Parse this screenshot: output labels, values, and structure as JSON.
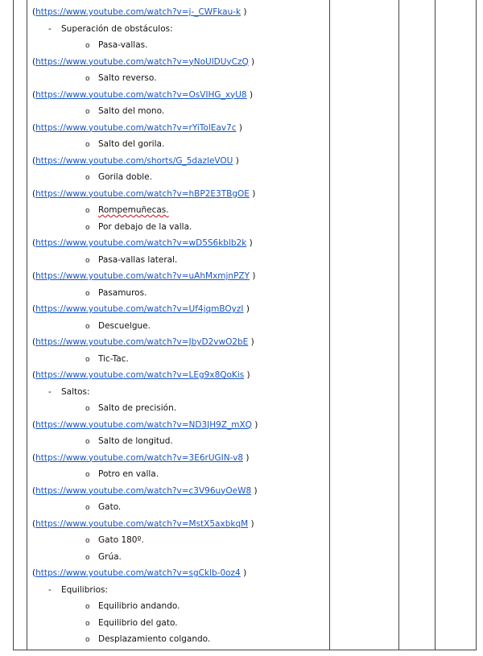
{
  "rows": [
    {
      "kind": "link",
      "url": "https://www.youtube.com/watch?v=j-_CWFkau-k"
    },
    {
      "kind": "section",
      "text": "Superación de obstáculos:"
    },
    {
      "kind": "item",
      "text": "Pasa-vallas."
    },
    {
      "kind": "link",
      "url": "https://www.youtube.com/watch?v=yNoUlDUyCzQ"
    },
    {
      "kind": "item",
      "text": "Salto reverso."
    },
    {
      "kind": "link",
      "url": "https://www.youtube.com/watch?v=OsVIHG_xyU8"
    },
    {
      "kind": "item",
      "text": "Salto del mono."
    },
    {
      "kind": "link",
      "url": "https://www.youtube.com/watch?v=rYiTolEav7c"
    },
    {
      "kind": "item",
      "text": "Salto del gorila."
    },
    {
      "kind": "link",
      "url": "https://www.youtube.com/shorts/G_5dazleVOU"
    },
    {
      "kind": "item",
      "text": "Gorila doble."
    },
    {
      "kind": "link",
      "url": "https://www.youtube.com/watch?v=hBP2E3TBgOE"
    },
    {
      "kind": "item",
      "text": "Rompemuñecas.",
      "spell": true
    },
    {
      "kind": "item",
      "text": "Por debajo de la valla."
    },
    {
      "kind": "link",
      "url": "https://www.youtube.com/watch?v=wD5S6kblb2k"
    },
    {
      "kind": "item",
      "text": "Pasa-vallas lateral."
    },
    {
      "kind": "link",
      "url": "https://www.youtube.com/watch?v=uAhMxmjnPZY"
    },
    {
      "kind": "item",
      "text": "Pasamuros."
    },
    {
      "kind": "link",
      "url": "https://www.youtube.com/watch?v=Uf4jqmBOyzI"
    },
    {
      "kind": "item",
      "text": "Descuelgue."
    },
    {
      "kind": "link",
      "url": "https://www.youtube.com/watch?v=JbyD2vwO2bE"
    },
    {
      "kind": "item",
      "text": "Tic-Tac."
    },
    {
      "kind": "link",
      "url": "https://www.youtube.com/watch?v=LEg9x8QoKis"
    },
    {
      "kind": "section",
      "text": "Saltos:"
    },
    {
      "kind": "item",
      "text": "Salto de precisión."
    },
    {
      "kind": "link",
      "url": "https://www.youtube.com/watch?v=ND3JH9Z_mXQ"
    },
    {
      "kind": "item",
      "text": "Salto de longitud."
    },
    {
      "kind": "link",
      "url": "https://www.youtube.com/watch?v=3E6rUGIN-v8"
    },
    {
      "kind": "item",
      "text": "Potro en valla."
    },
    {
      "kind": "link",
      "url": "https://www.youtube.com/watch?v=c3V96uyOeW8"
    },
    {
      "kind": "item",
      "text": "Gato."
    },
    {
      "kind": "link",
      "url": "https://www.youtube.com/watch?v=MstX5axbkqM"
    },
    {
      "kind": "item",
      "text": "Gato 180º."
    },
    {
      "kind": "item",
      "text": "Grúa."
    },
    {
      "kind": "link",
      "url": "https://www.youtube.com/watch?v=sgCklb-0oz4"
    },
    {
      "kind": "section",
      "text": "Equilibrios:"
    },
    {
      "kind": "item",
      "text": "Equilibrio andando."
    },
    {
      "kind": "item",
      "text": "Equilibrio del gato."
    },
    {
      "kind": "item",
      "text": "Desplazamiento colgando."
    }
  ],
  "glyphs": {
    "bullet": "o",
    "dash": "-",
    "open_paren": "(",
    "close_paren": " )"
  },
  "colors": {
    "link": "#1a56c6",
    "border": "#444444",
    "spellcheck": "#d02020"
  }
}
